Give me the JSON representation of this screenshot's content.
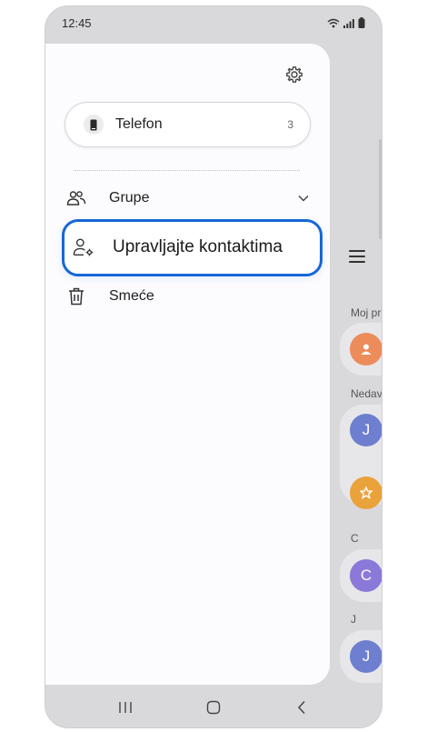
{
  "status_bar": {
    "time": "12:45"
  },
  "drawer": {
    "account": {
      "label": "Telefon",
      "count": "3"
    },
    "items": [
      {
        "label": "Grupe"
      },
      {
        "label": "Upravljajte kontaktima"
      },
      {
        "label": "Smeće"
      }
    ]
  },
  "background": {
    "sections": [
      "Moj pr",
      "Nedav",
      "C",
      "J"
    ],
    "avatars": [
      "J",
      "C",
      "J"
    ]
  },
  "colors": {
    "highlight": "#1667d6",
    "avatar_orange": "#ec8c5a",
    "avatar_indigo": "#6e7fcf",
    "avatar_star": "#eaa23a",
    "avatar_purple": "#8a79d9"
  }
}
